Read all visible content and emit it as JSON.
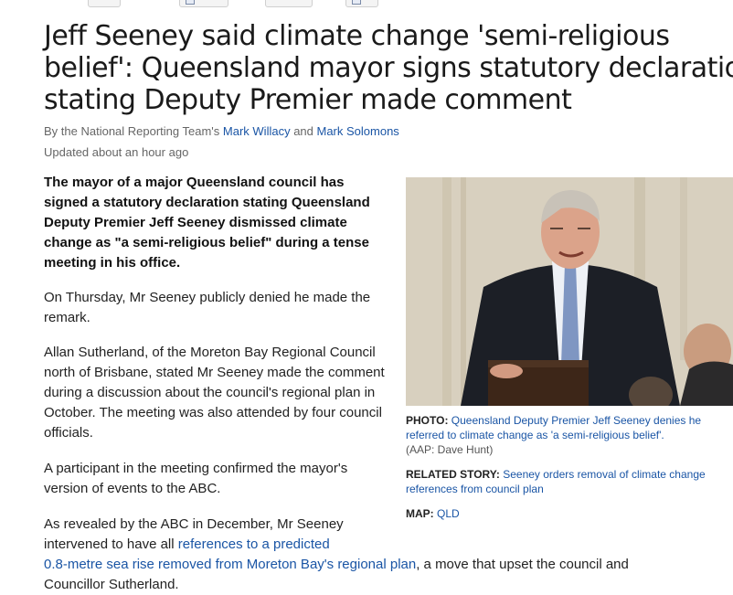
{
  "article": {
    "headline_line1": "Jeff Seeney said climate change 'semi-religious",
    "headline_line2": "belief': Queensland mayor signs statutory declaration",
    "headline_line3": "stating Deputy Premier made comment",
    "byline_prefix": "By the National Reporting Team's ",
    "author1": "Mark Willacy",
    "byline_and": " and ",
    "author2": "Mark Solomons",
    "updated": "Updated about an hour ago",
    "lead_paragraph": "The mayor of a major Queensland council has signed a statutory declaration stating Queensland Deputy Premier Jeff Seeney dismissed climate change as \"a semi-religious belief\" during a tense meeting in his office.",
    "paragraph2": "On Thursday, Mr Seeney publicly denied he made the remark.",
    "paragraph3": "Allan Sutherland, of the Moreton Bay Regional Council north of Brisbane, stated Mr Seeney made the comment during a discussion about the council's regional plan in October. The meeting was also attended by four council officials.",
    "paragraph4": "A participant in the meeting confirmed the mayor's version of events to the ABC.",
    "paragraph5_a": "As revealed by the ABC in December, Mr Seeney",
    "paragraph5_b": "intervened to have all ",
    "paragraph5_link1": "references to a predicted",
    "paragraph5_link2": "0.8-metre sea rise removed from Moreton Bay's regional plan",
    "paragraph5_c": ", a move that upset the council and",
    "paragraph5_d": "Councillor Sutherland."
  },
  "sidebar": {
    "photo_label": "PHOTO:",
    "photo_caption_line1": " Queensland Deputy Premier Jeff Seeney denies he",
    "photo_caption_line2": "referred to climate change as 'a semi-religious belief'.",
    "photo_credit": "(AAP: Dave Hunt)",
    "related_label": "RELATED STORY:",
    "related_link_line1": " Seeney orders removal of climate change",
    "related_link_line2": "references from council plan",
    "map_label": "MAP:",
    "map_link": " QLD"
  },
  "colors": {
    "link": "#1a55a5",
    "headline": "#1a1a1a",
    "meta": "#666666"
  }
}
